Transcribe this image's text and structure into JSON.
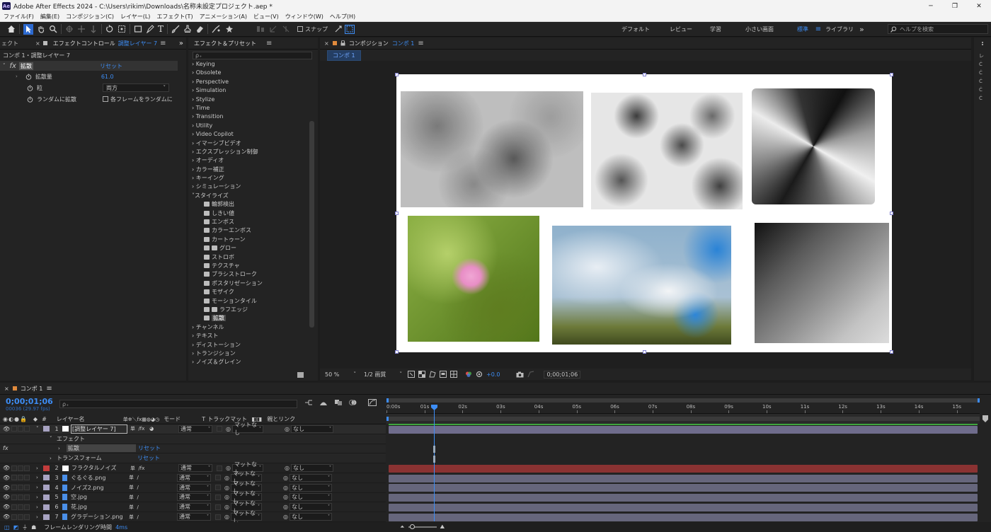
{
  "window": {
    "app_badge": "Ae",
    "title": "Adobe After Effects 2024 - C:\\Users\\rikim\\Downloads\\名称未設定プロジェクト.aep *",
    "minimize": "─",
    "maximize": "❐",
    "close": "✕"
  },
  "menu": [
    "ファイル(F)",
    "編集(E)",
    "コンポジション(C)",
    "レイヤー(L)",
    "エフェクト(T)",
    "アニメーション(A)",
    "ビュー(V)",
    "ウィンドウ(W)",
    "ヘルプ(H)"
  ],
  "toolbar": {
    "snap_label": "スナップ",
    "workspaces": [
      "デフォルト",
      "レビュー",
      "学習",
      "小さい画面",
      "標準",
      "ライブラリ"
    ],
    "active_workspace": "標準",
    "more": "»",
    "help_search_placeholder": "ヘルプを検索"
  },
  "effect_controls": {
    "tab_left": "ェクト",
    "tab_prefix": "エフェクトコントロール",
    "tab_layer": "調整レイヤー 7",
    "layer_path": "コンポ 1・調整レイヤー 7",
    "fx_label": "fx",
    "effect_name": "拡散",
    "reset": "リセット",
    "props": [
      {
        "name": "拡散量",
        "value": "61.0"
      },
      {
        "name": "粒",
        "value": "両方"
      },
      {
        "name": "ランダムに拡散",
        "value": "各フレームをランダムに"
      }
    ]
  },
  "effects_presets": {
    "title": "エフェクト＆プリセット",
    "search_placeholder": "ρ₊",
    "categories_top": [
      "Keying",
      "Obsolete",
      "Perspective",
      "Simulation",
      "Stylize",
      "Time",
      "Transition",
      "Utility",
      "Video Copilot",
      "イマーシブビデオ",
      "エクスプレッション制御",
      "オーディオ",
      "カラー補正",
      "キーイング",
      "シミュレーション"
    ],
    "open_category": "スタイライズ",
    "stylize_items": [
      "輪郭検出",
      "しきい値",
      "エンボス",
      "カラーエンボス",
      "カートゥーン",
      "グロー",
      "ストロボ",
      "テクスチャ",
      "ブラシストローク",
      "ポスタリゼーション",
      "モザイク",
      "モーションタイル",
      "ラフエッジ",
      "拡散"
    ],
    "selected_item": "拡散",
    "categories_bottom": [
      "チャンネル",
      "テキスト",
      "ディストーション",
      "トランジション",
      "ノイズ＆グレイン"
    ]
  },
  "composition": {
    "tab_prefix": "コンポジション",
    "tab_name": "コンポ 1",
    "breadcrumb": "コンポ 1",
    "zoom": "50 %",
    "resolution": "1/2 画質",
    "exposure": "+0.0",
    "timecode": "0;00;01;06"
  },
  "timeline": {
    "tab": "コンポ 1",
    "timecode": "0;00;01;06",
    "fps": "00036 (29.97 fps)",
    "search_placeholder": "ρ₊",
    "col_num": "#",
    "col_layer": "レイヤー名",
    "col_mode": "モード",
    "col_t": "T",
    "col_trackmatte": "トラックマット",
    "col_parent": "親とリンク",
    "ruler": [
      "0:00s",
      "01s",
      "02s",
      "03s",
      "04s",
      "05s",
      "06s",
      "07s",
      "08s",
      "09s",
      "10s",
      "11s",
      "12s",
      "13s",
      "14s",
      "15s"
    ],
    "layers": [
      {
        "num": "1",
        "name": "[調整レイヤー 7]",
        "mode": "通常",
        "matte": "マットなし",
        "parent": "なし",
        "color": "#a8a3c2",
        "bar": "#6f6c8c",
        "fx": true,
        "adj": true
      },
      {
        "num": "2",
        "name": "フラクタルノイズ",
        "mode": "通常",
        "matte": "マットなし",
        "parent": "なし",
        "color": "#c23c3c",
        "bar": "#8a3232",
        "fx": true,
        "adj": false
      },
      {
        "num": "3",
        "name": "ぐるぐる.png",
        "mode": "通常",
        "matte": "マットなし",
        "parent": "なし",
        "color": "#a8a3c2",
        "bar": "#66667c",
        "fx": false,
        "adj": false
      },
      {
        "num": "4",
        "name": "ノイズ2.png",
        "mode": "通常",
        "matte": "マットなし",
        "parent": "なし",
        "color": "#a8a3c2",
        "bar": "#66667c",
        "fx": false,
        "adj": false
      },
      {
        "num": "5",
        "name": "空.jpg",
        "mode": "通常",
        "matte": "マットなし",
        "parent": "なし",
        "color": "#a8a3c2",
        "bar": "#66667c",
        "fx": false,
        "adj": false
      },
      {
        "num": "6",
        "name": "花.jpg",
        "mode": "通常",
        "matte": "マットなし",
        "parent": "なし",
        "color": "#a8a3c2",
        "bar": "#66667c",
        "fx": false,
        "adj": false
      },
      {
        "num": "7",
        "name": "グラデーション.png",
        "mode": "通常",
        "matte": "マットなし",
        "parent": "なし",
        "color": "#a8a3c2",
        "bar": "#66667c",
        "fx": false,
        "adj": false
      }
    ],
    "effect_group": "エフェクト",
    "effect_name": "拡散",
    "transform_group": "トランスフォーム",
    "reset": "リセット",
    "footer": "フレームレンダリング時間",
    "footer_value": "4ms"
  },
  "colors": {
    "accent": "#3d8df5",
    "panel": "#232323",
    "background": "#1d1d1d"
  }
}
